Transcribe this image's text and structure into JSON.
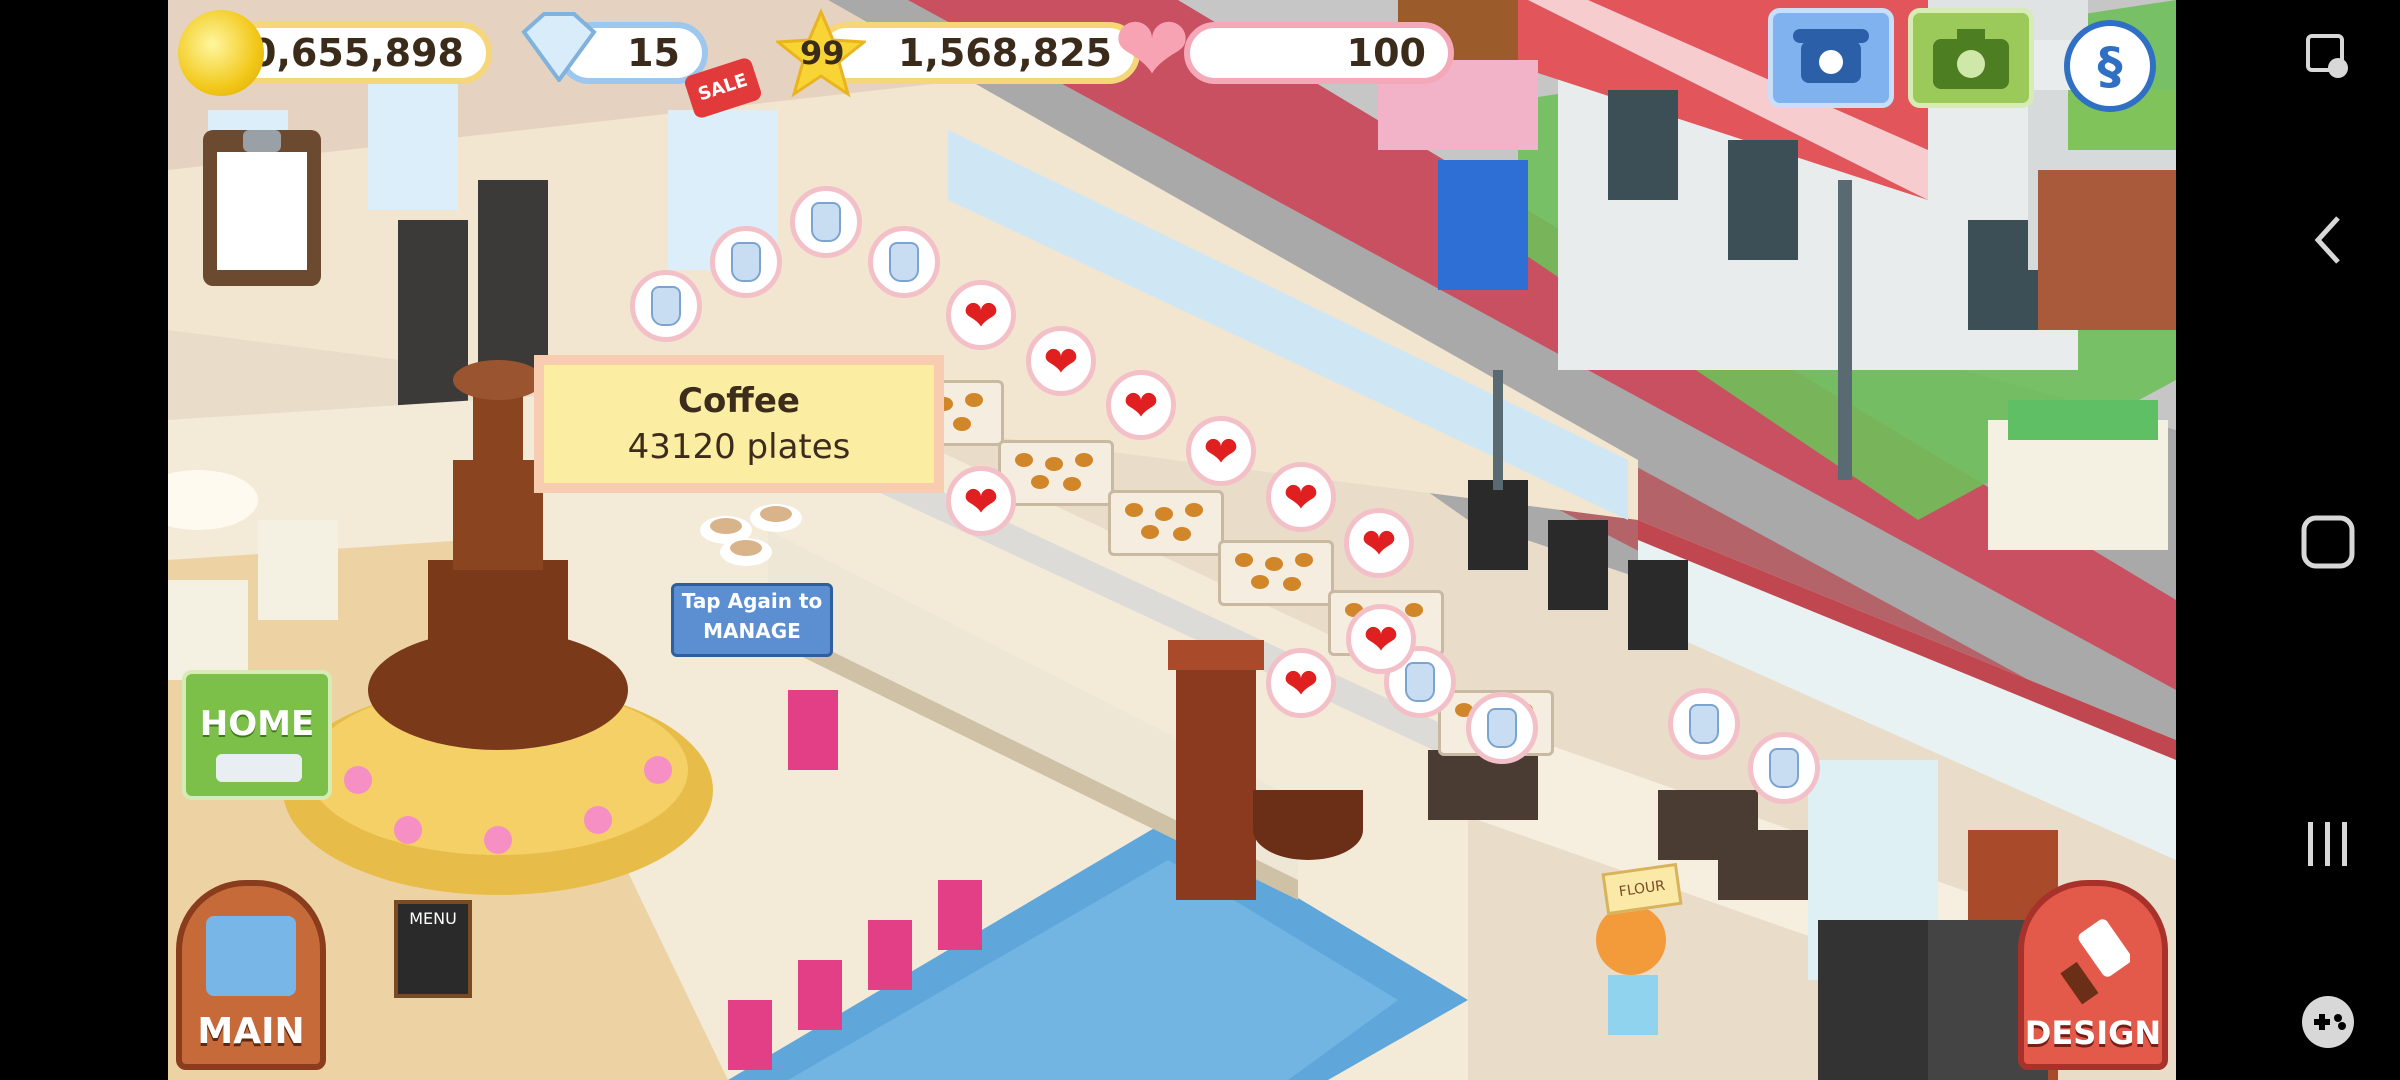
{
  "hud": {
    "coins": "40,655,898",
    "gems": "15",
    "sale_badge": "SALE",
    "level": "99",
    "stars": "1,568,825",
    "hearts": "100"
  },
  "tooltip": {
    "item_name": "Coffee",
    "plates": "43120 plates"
  },
  "manage_hint": {
    "line1": "Tap Again to",
    "line2": "MANAGE"
  },
  "buttons": {
    "home": "HOME",
    "main": "MAIN",
    "design": "DESIGN"
  },
  "scenery": {
    "menu_sign": "MENU",
    "flower_sign": "FLOUR"
  },
  "icons": {
    "coin": "coin-icon",
    "gem": "diamond-icon",
    "star": "star-icon",
    "heart": "heart-icon",
    "phone": "phone-icon",
    "camera": "camera-icon",
    "social": "social-icon",
    "clipboard": "clipboard-icon"
  },
  "colors": {
    "coin_border": "#f5d77a",
    "gem_border": "#9cc7ef",
    "heart_border": "#f4a8b8",
    "tooltip_bg": "#fbeea2",
    "manage_bg": "#5b8fd1",
    "heart_red": "#e02020"
  }
}
